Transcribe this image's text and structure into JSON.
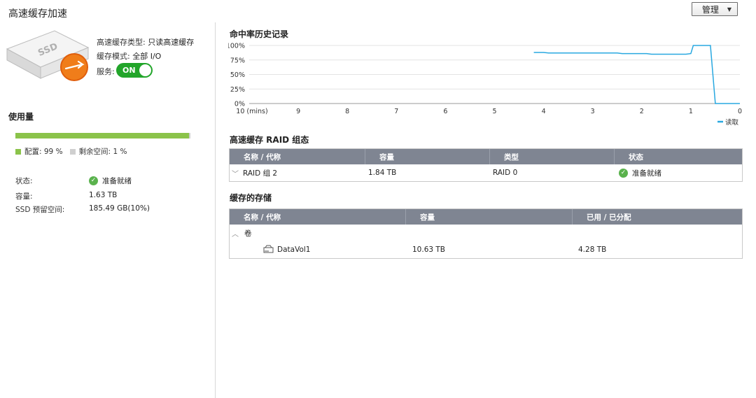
{
  "page": {
    "title": "高速缓存加速",
    "manage_label": "管理"
  },
  "summary": {
    "ssd_text": "SSD",
    "cache_type_label": "高速缓存类型:",
    "cache_type_value": "只读高速缓存",
    "cache_mode_label": "缓存模式:",
    "cache_mode_value": "全部 I/O",
    "service_label": "服务:",
    "service_toggle": "ON"
  },
  "usage": {
    "title": "使用量",
    "allocated_percent": 99,
    "allocated_label": "配置: 99 %",
    "free_label": "剩余空间: 1 %",
    "colors": {
      "allocated": "#8bc34a",
      "free": "#cfcfcf"
    },
    "status_label": "状态:",
    "status_value": "准备就绪",
    "capacity_label": "容量:",
    "capacity_value": "1.63 TB",
    "reserved_label": "SSD 预留空间:",
    "reserved_value": "185.49 GB(10%)"
  },
  "chart_data": {
    "type": "line",
    "title": "命中率历史记录",
    "xlabel": "",
    "ylabel": "",
    "x_tick_labels": [
      "10 (mins)",
      "9",
      "8",
      "7",
      "6",
      "5",
      "4",
      "3",
      "2",
      "1",
      "0"
    ],
    "y_tick_labels": [
      "0%",
      "25%",
      "50%",
      "75%",
      "100%"
    ],
    "xlim": [
      10,
      0
    ],
    "ylim": [
      0,
      100
    ],
    "grid": true,
    "legend_position": "bottom-right",
    "series": [
      {
        "name": "读取",
        "color": "#29a8e0",
        "points": [
          [
            4.2,
            88
          ],
          [
            4.0,
            88
          ],
          [
            3.9,
            87
          ],
          [
            3.5,
            87
          ],
          [
            3.0,
            87
          ],
          [
            2.5,
            87
          ],
          [
            2.4,
            86
          ],
          [
            2.0,
            86
          ],
          [
            1.9,
            86
          ],
          [
            1.8,
            85
          ],
          [
            1.5,
            85
          ],
          [
            1.1,
            85
          ],
          [
            1.0,
            86
          ],
          [
            0.95,
            100
          ],
          [
            0.6,
            100
          ],
          [
            0.55,
            50
          ],
          [
            0.5,
            0
          ],
          [
            0,
            0
          ]
        ]
      }
    ]
  },
  "raid": {
    "title": "高速缓存 RAID 组态",
    "columns": [
      "名称 / 代称",
      "容量",
      "类型",
      "状态"
    ],
    "rows": [
      {
        "name": "RAID 组 2",
        "capacity": "1.84 TB",
        "type": "RAID 0",
        "status": "准备就绪"
      }
    ]
  },
  "storage": {
    "title": "缓存的存储",
    "columns": [
      "名称 / 代称",
      "容量",
      "已用 / 已分配"
    ],
    "group_label": "卷",
    "rows": [
      {
        "name": "DataVol1",
        "capacity": "10.63 TB",
        "used": "4.28 TB"
      }
    ]
  }
}
